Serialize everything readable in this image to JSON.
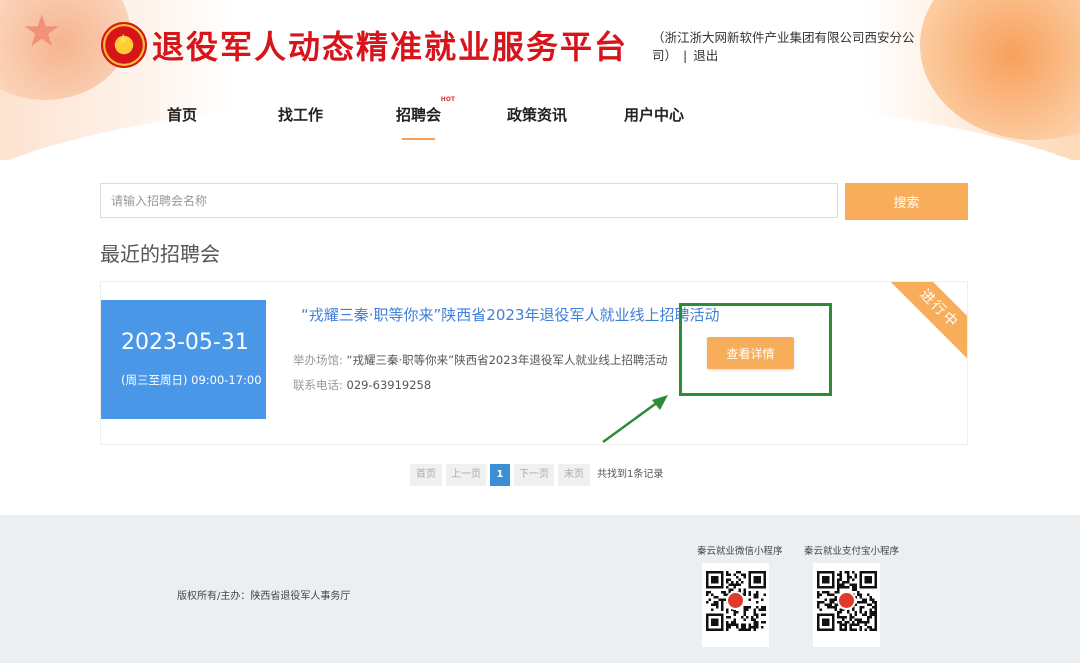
{
  "header": {
    "site_title": "退役军人动态精准就业服务平台",
    "user_org": "（浙江浙大网新软件产业集团有限公司西安分公司）",
    "separator": "|",
    "logout": "退出"
  },
  "nav": {
    "items": [
      {
        "label": "首页"
      },
      {
        "label": "找工作"
      },
      {
        "label": "招聘会",
        "badge": "HOT",
        "active": true
      },
      {
        "label": "政策资讯"
      },
      {
        "label": "用户中心"
      }
    ]
  },
  "search": {
    "placeholder": "请输入招聘会名称",
    "value": "",
    "button": "搜索"
  },
  "section_title": "最近的招聘会",
  "fair": {
    "date": "2023-05-31",
    "time": "(周三至周日)  09:00-17:00",
    "title": "“戎耀三秦·职等你来”陕西省2023年退役军人就业线上招聘活动",
    "venue_label": "举办场馆:",
    "venue": "“戎耀三秦·职等你来”陕西省2023年退役军人就业线上招聘活动",
    "phone_label": "联系电话:",
    "phone": "029-63919258",
    "detail_button": "查看详情",
    "status_ribbon": "进行中"
  },
  "pagination": {
    "first": "首页",
    "prev": "上一页",
    "current": "1",
    "next": "下一页",
    "last": "末页",
    "total": "共找到1条记录"
  },
  "footer": {
    "copyright": "版权所有/主办：陕西省退役军人事务厅",
    "qr_wechat_title": "秦云就业微信小程序",
    "qr_alipay_title": "秦云就业支付宝小程序"
  },
  "colors": {
    "brand_red": "#d8141b",
    "accent_orange": "#f8ad5a",
    "date_blue": "#4a97e8",
    "highlight_green": "#2e8b36"
  }
}
